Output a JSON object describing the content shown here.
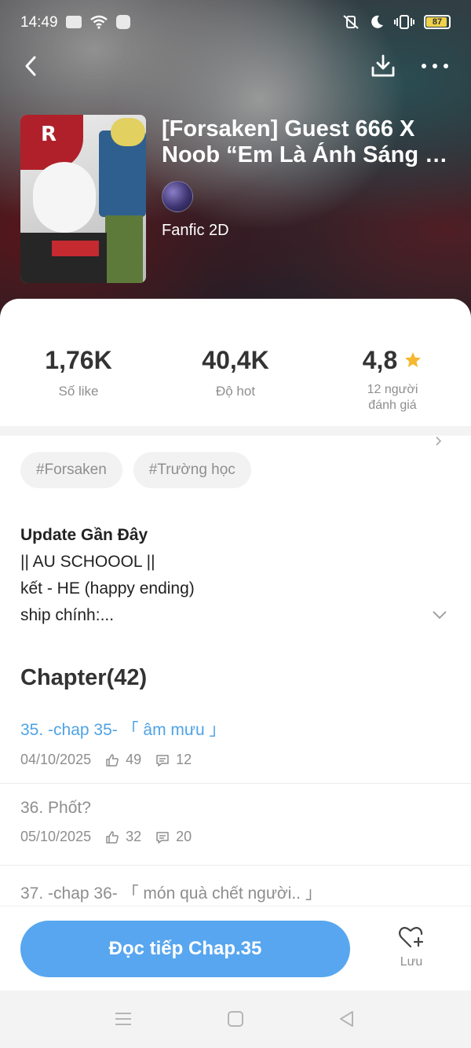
{
  "status_bar": {
    "time": "14:49",
    "battery": "87"
  },
  "header": {
    "title_line1": "[Forsaken] Guest 666 X",
    "title_line2": "Noob “Em Là Ánh Sáng Củ...",
    "genre": "Fanfic 2D"
  },
  "stats": [
    {
      "value": "1,76K",
      "label": "Số like"
    },
    {
      "value": "40,4K",
      "label": "Độ hot"
    },
    {
      "value": "4,8",
      "label_line1": "12 người",
      "label_line2": "đánh giá"
    }
  ],
  "tags": [
    "#Forsaken",
    "#Trường học"
  ],
  "description": {
    "heading": "Update Gần Đây",
    "lines": [
      "|| AU SCHOOOL ||",
      "kết - HE (happy ending)",
      "ship chính:..."
    ]
  },
  "chapters_header": "Chapter(42)",
  "chapters": [
    {
      "name": "35. -chap 35- 「 âm mưu 」",
      "date": "04/10/2025",
      "likes": "49",
      "comments": "12"
    },
    {
      "name": "36. Phốt?",
      "date": "05/10/2025",
      "likes": "32",
      "comments": "20"
    },
    {
      "name": "37. -chap 36- 「 món quà chết người.. 」"
    }
  ],
  "actions": {
    "read_button": "Đọc tiếp Chap.35",
    "save_label": "Lưu"
  },
  "colors": {
    "accent": "#58a6ef",
    "link": "#4ea3e6",
    "star": "#f5b82e"
  }
}
